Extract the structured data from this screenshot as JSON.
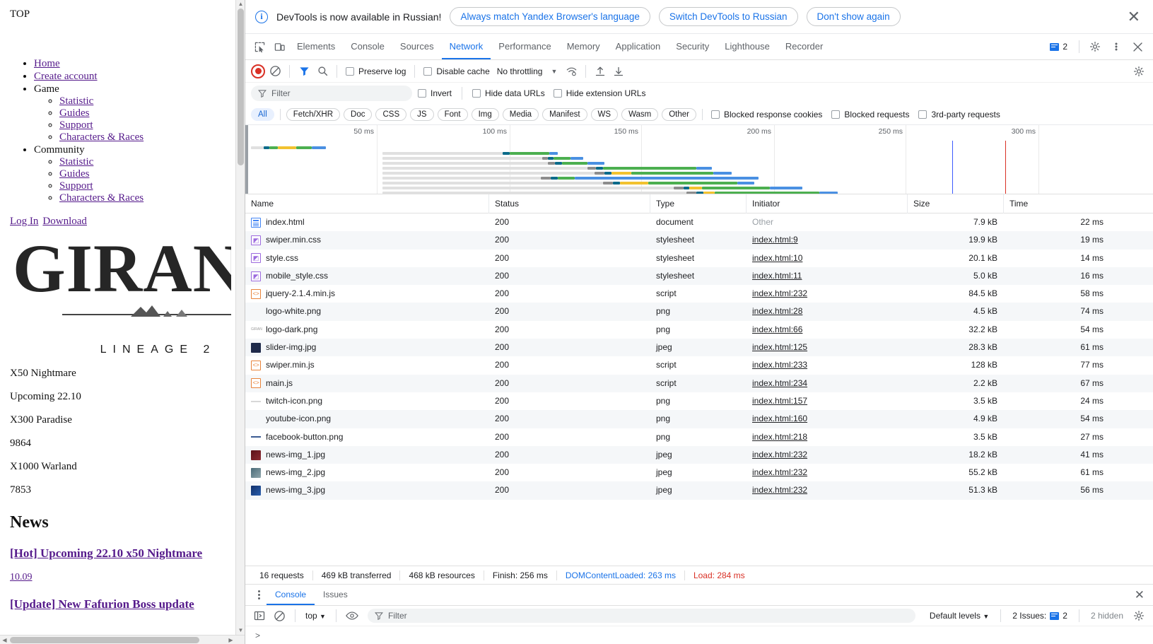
{
  "page": {
    "top_label": "TOP",
    "nav": [
      {
        "label": "Home",
        "link": true,
        "children": []
      },
      {
        "label": "Create account",
        "link": true,
        "children": []
      },
      {
        "label": "Game",
        "link": false,
        "children": [
          "Statistic",
          "Guides",
          "Support",
          "Characters & Races"
        ]
      },
      {
        "label": "Community",
        "link": false,
        "children": [
          "Statistic",
          "Guides",
          "Support",
          "Characters & Races"
        ]
      }
    ],
    "auth_links": [
      "Log In",
      "Download"
    ],
    "logo_word": "GIRAN",
    "logo_sub": "LINEAGE 2",
    "servers": [
      "X50 Nightmare",
      "Upcoming 22.10",
      "X300 Paradise",
      "9864",
      "X1000 Warland",
      "7853"
    ],
    "news_heading": "News",
    "news": [
      {
        "title": "[Hot] Upcoming 22.10 x50 Nightmare",
        "date": "10.09"
      },
      {
        "title": "[Update] New Fafurion Boss update",
        "date": ""
      }
    ]
  },
  "banner": {
    "message": "DevTools is now available in Russian!",
    "buttons": [
      "Always match Yandex Browser's language",
      "Switch DevTools to Russian",
      "Don't show again"
    ],
    "close_icon": "close-icon",
    "info_icon": "info-icon"
  },
  "tabstrip": {
    "icons": [
      "inspect-element-icon",
      "device-toolbar-icon"
    ],
    "tabs": [
      "Elements",
      "Console",
      "Sources",
      "Network",
      "Performance",
      "Memory",
      "Application",
      "Security",
      "Lighthouse",
      "Recorder"
    ],
    "active_tab": "Network",
    "issues_count": "2",
    "settings_icon": "gear-icon",
    "more_icon": "more-vertical-icon",
    "close_icon": "close-icon"
  },
  "network_toolbar": {
    "record_icon": "record-stop-icon",
    "clear_icon": "clear-icon",
    "filter_icon": "filter-icon",
    "search_icon": "search-icon",
    "preserve_log": "Preserve log",
    "disable_cache": "Disable cache",
    "throttling": "No throttling",
    "throttle_caret": "chevron-down-icon",
    "network_conditions_icon": "wifi-settings-icon",
    "import_har_icon": "upload-icon",
    "export_har_icon": "download-icon",
    "settings_icon": "gear-icon"
  },
  "filter_row": {
    "placeholder": "Filter",
    "filter_icon": "filter-icon",
    "invert": "Invert",
    "hide_data_urls": "Hide data URLs",
    "hide_extension_urls": "Hide extension URLs"
  },
  "type_filters": {
    "chips": [
      "All",
      "Fetch/XHR",
      "Doc",
      "CSS",
      "JS",
      "Font",
      "Img",
      "Media",
      "Manifest",
      "WS",
      "Wasm",
      "Other"
    ],
    "active": "All",
    "checkboxes": [
      "Blocked response cookies",
      "Blocked requests",
      "3rd-party requests"
    ]
  },
  "overview": {
    "ticks": [
      "50 ms",
      "100 ms",
      "150 ms",
      "200 ms",
      "250 ms",
      "300 ms"
    ],
    "dcl_color": "#3d5afe",
    "load_color": "#d93025"
  },
  "table": {
    "columns": [
      "Name",
      "Status",
      "Type",
      "Initiator",
      "Size",
      "Time"
    ],
    "rows": [
      {
        "icon": "document-icon",
        "name": "index.html",
        "status": "200",
        "type": "document",
        "initiator": "Other",
        "initiator_link": false,
        "size": "7.9 kB",
        "time": "22 ms"
      },
      {
        "icon": "stylesheet-icon",
        "name": "swiper.min.css",
        "status": "200",
        "type": "stylesheet",
        "initiator": "index.html:9",
        "initiator_link": true,
        "size": "19.9 kB",
        "time": "19 ms"
      },
      {
        "icon": "stylesheet-icon",
        "name": "style.css",
        "status": "200",
        "type": "stylesheet",
        "initiator": "index.html:10",
        "initiator_link": true,
        "size": "20.1 kB",
        "time": "14 ms"
      },
      {
        "icon": "stylesheet-icon",
        "name": "mobile_style.css",
        "status": "200",
        "type": "stylesheet",
        "initiator": "index.html:11",
        "initiator_link": true,
        "size": "5.0 kB",
        "time": "16 ms"
      },
      {
        "icon": "script-icon",
        "name": "jquery-2.1.4.min.js",
        "status": "200",
        "type": "script",
        "initiator": "index.html:232",
        "initiator_link": true,
        "size": "84.5 kB",
        "time": "58 ms"
      },
      {
        "icon": "image-blank-icon",
        "name": "logo-white.png",
        "status": "200",
        "type": "png",
        "initiator": "index.html:28",
        "initiator_link": true,
        "size": "4.5 kB",
        "time": "74 ms"
      },
      {
        "icon": "image-text-icon",
        "name": "logo-dark.png",
        "status": "200",
        "type": "png",
        "initiator": "index.html:66",
        "initiator_link": true,
        "size": "32.2 kB",
        "time": "54 ms"
      },
      {
        "icon": "image-dark-icon",
        "name": "slider-img.jpg",
        "status": "200",
        "type": "jpeg",
        "initiator": "index.html:125",
        "initiator_link": true,
        "size": "28.3 kB",
        "time": "61 ms"
      },
      {
        "icon": "script-icon",
        "name": "swiper.min.js",
        "status": "200",
        "type": "script",
        "initiator": "index.html:233",
        "initiator_link": true,
        "size": "128 kB",
        "time": "77 ms"
      },
      {
        "icon": "script-icon",
        "name": "main.js",
        "status": "200",
        "type": "script",
        "initiator": "index.html:234",
        "initiator_link": true,
        "size": "2.2 kB",
        "time": "67 ms"
      },
      {
        "icon": "image-faint-icon",
        "name": "twitch-icon.png",
        "status": "200",
        "type": "png",
        "initiator": "index.html:157",
        "initiator_link": true,
        "size": "3.5 kB",
        "time": "24 ms"
      },
      {
        "icon": "image-blank-icon",
        "name": "youtube-icon.png",
        "status": "200",
        "type": "png",
        "initiator": "index.html:160",
        "initiator_link": true,
        "size": "4.9 kB",
        "time": "54 ms"
      },
      {
        "icon": "image-dash-icon",
        "name": "facebook-button.png",
        "status": "200",
        "type": "png",
        "initiator": "index.html:218",
        "initiator_link": true,
        "size": "3.5 kB",
        "time": "27 ms"
      },
      {
        "icon": "image-red-icon",
        "name": "news-img_1.jpg",
        "status": "200",
        "type": "jpeg",
        "initiator": "index.html:232",
        "initiator_link": true,
        "size": "18.2 kB",
        "time": "41 ms"
      },
      {
        "icon": "image-teal-icon",
        "name": "news-img_2.jpg",
        "status": "200",
        "type": "jpeg",
        "initiator": "index.html:232",
        "initiator_link": true,
        "size": "55.2 kB",
        "time": "61 ms"
      },
      {
        "icon": "image-blue-icon",
        "name": "news-img_3.jpg",
        "status": "200",
        "type": "jpeg",
        "initiator": "index.html:232",
        "initiator_link": true,
        "size": "51.3 kB",
        "time": "56 ms"
      }
    ]
  },
  "summary": {
    "requests": "16 requests",
    "transferred": "469 kB transferred",
    "resources": "468 kB resources",
    "finish": "Finish: 256 ms",
    "dcl": "DOMContentLoaded: 263 ms",
    "load": "Load: 284 ms"
  },
  "drawer": {
    "tabs": [
      "Console",
      "Issues"
    ],
    "active_tab": "Console",
    "more_icon": "more-vertical-icon",
    "close_icon": "close-icon",
    "sidebar_icon": "show-sidebar-icon",
    "clear_icon": "clear-console-icon",
    "context": "top",
    "context_caret": "chevron-down-icon",
    "eye_icon": "live-expression-icon",
    "filter_placeholder": "Filter",
    "levels": "Default levels",
    "levels_caret": "chevron-down-icon",
    "issues_label": "2 Issues:",
    "issues_count": "2",
    "hidden": "2 hidden",
    "settings_icon": "gear-icon",
    "prompt": ">"
  }
}
